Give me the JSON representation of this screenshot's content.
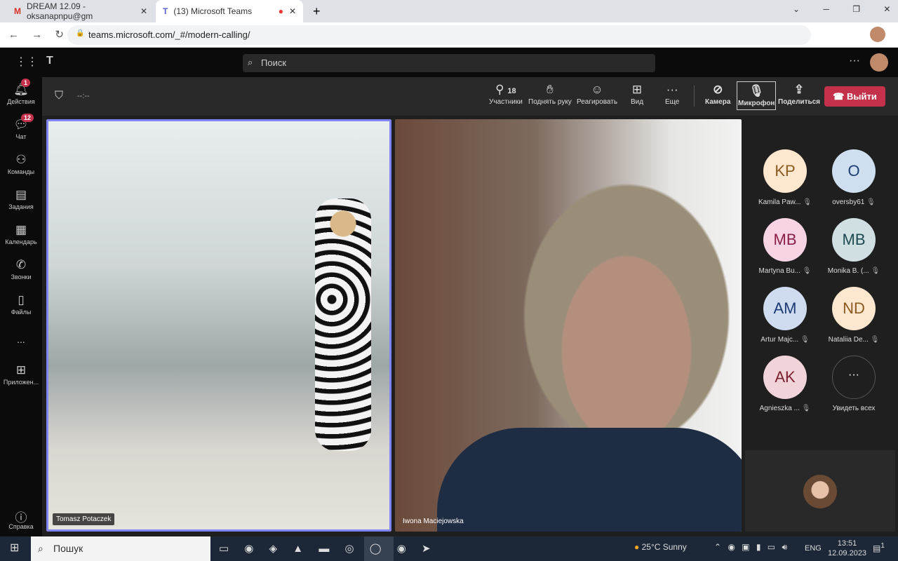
{
  "browser": {
    "tabs": [
      {
        "title": "DREAM 12.09 - oksanapnpu@gm"
      },
      {
        "title": "(13) Microsoft Teams"
      }
    ],
    "url": "teams.microsoft.com/_#/modern-calling/"
  },
  "teams": {
    "search_placeholder": "Поиск"
  },
  "rail": [
    {
      "label": "Действия",
      "badge": "1",
      "icon": "bell-icon"
    },
    {
      "label": "Чат",
      "badge": "12",
      "icon": "chat-icon"
    },
    {
      "label": "Команды",
      "icon": "teams-icon"
    },
    {
      "label": "Задания",
      "icon": "assignments-icon"
    },
    {
      "label": "Календарь",
      "icon": "calendar-icon"
    },
    {
      "label": "Звонки",
      "icon": "phone-icon"
    },
    {
      "label": "Файлы",
      "icon": "file-icon"
    },
    {
      "label": "...",
      "icon": "more-icon"
    },
    {
      "label": "Приложен...",
      "icon": "apps-icon"
    },
    {
      "label": "Справка",
      "icon": "help-icon"
    }
  ],
  "meeting": {
    "timer": "--:--",
    "participants_count": "18",
    "buttons": {
      "participants": "Участники",
      "raise_hand": "Поднять руку",
      "react": "Реагировать",
      "view": "Вид",
      "more": "Еще",
      "camera": "Камера",
      "mic": "Микрофон",
      "share": "Поделиться",
      "leave": "Выйти"
    },
    "videos": [
      {
        "name": "Tomasz Potaczek"
      },
      {
        "name": "Iwona Maciejowska"
      }
    ],
    "participants": [
      {
        "initials": "KP",
        "name": "Kamila Paw...",
        "bg": "#fde7cf",
        "fg": "#8a5a1e"
      },
      {
        "initials": "O",
        "name": "oversby61",
        "bg": "#cfdff0",
        "fg": "#1b3f74"
      },
      {
        "initials": "MB",
        "name": "Martyna Bu...",
        "bg": "#f6d4e3",
        "fg": "#8a1f45"
      },
      {
        "initials": "MB",
        "name": "Monika B. (...",
        "bg": "#cfdfe2",
        "fg": "#1e4a52"
      },
      {
        "initials": "AM",
        "name": "Artur Majc...",
        "bg": "#cfdcf0",
        "fg": "#1b3a74"
      },
      {
        "initials": "ND",
        "name": "Nataliia De...",
        "bg": "#fde7cf",
        "fg": "#8a5a1e"
      },
      {
        "initials": "AK",
        "name": "Agnieszka ...",
        "bg": "#f0d4d9",
        "fg": "#7a1f2d"
      }
    ],
    "see_all": "Увидеть всех"
  },
  "taskbar": {
    "search": "Пошук",
    "weather": "25°C  Sunny",
    "lang": "ENG",
    "time": "13:51",
    "date": "12.09.2023",
    "notif": "1"
  }
}
